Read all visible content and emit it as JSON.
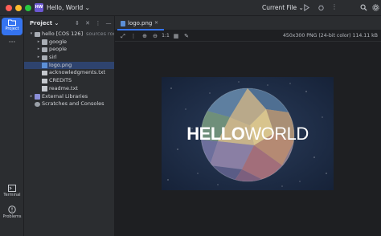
{
  "window": {
    "badge": "HW",
    "project_name": "Hello, World",
    "run_config": "Current File"
  },
  "toolstrip": {
    "project_label": "Project",
    "terminal_label": "Terminal",
    "problems_label": "Problems"
  },
  "project_panel": {
    "title": "Project",
    "tree": [
      {
        "label": "hello [COS 126]",
        "extra": "sources root,",
        "type": "folder",
        "depth": 0,
        "arrow": "open"
      },
      {
        "label": "google",
        "extra": "",
        "type": "folder",
        "depth": 1,
        "arrow": "closed"
      },
      {
        "label": "people",
        "extra": "",
        "type": "folder",
        "depth": 1,
        "arrow": "closed"
      },
      {
        "label": "sirl",
        "extra": "",
        "type": "folder",
        "depth": 1,
        "arrow": "closed"
      },
      {
        "label": "logo.png",
        "extra": "",
        "type": "png",
        "depth": 1,
        "arrow": "",
        "selected": true
      },
      {
        "label": "acknowledgments.txt",
        "extra": "",
        "type": "file",
        "depth": 1,
        "arrow": ""
      },
      {
        "label": "CREDITS",
        "extra": "",
        "type": "file",
        "depth": 1,
        "arrow": ""
      },
      {
        "label": "readme.txt",
        "extra": "",
        "type": "file",
        "depth": 1,
        "arrow": ""
      },
      {
        "label": "External Libraries",
        "extra": "",
        "type": "lib",
        "depth": 0,
        "arrow": "closed"
      },
      {
        "label": "Scratches and Consoles",
        "extra": "",
        "type": "scratch",
        "depth": 0,
        "arrow": ""
      }
    ]
  },
  "editor": {
    "tab_label": "logo.png",
    "zoom_ratio": "1:1",
    "image_info": "450x300 PNG (24-bit color) 114.11 kB",
    "image_text_bold": "HELLO",
    "image_text_light": "WORLD"
  },
  "colors": {
    "accent": "#3574f0",
    "background": "#1e1f22",
    "panel": "#2b2d30",
    "selection": "#2e436e"
  }
}
